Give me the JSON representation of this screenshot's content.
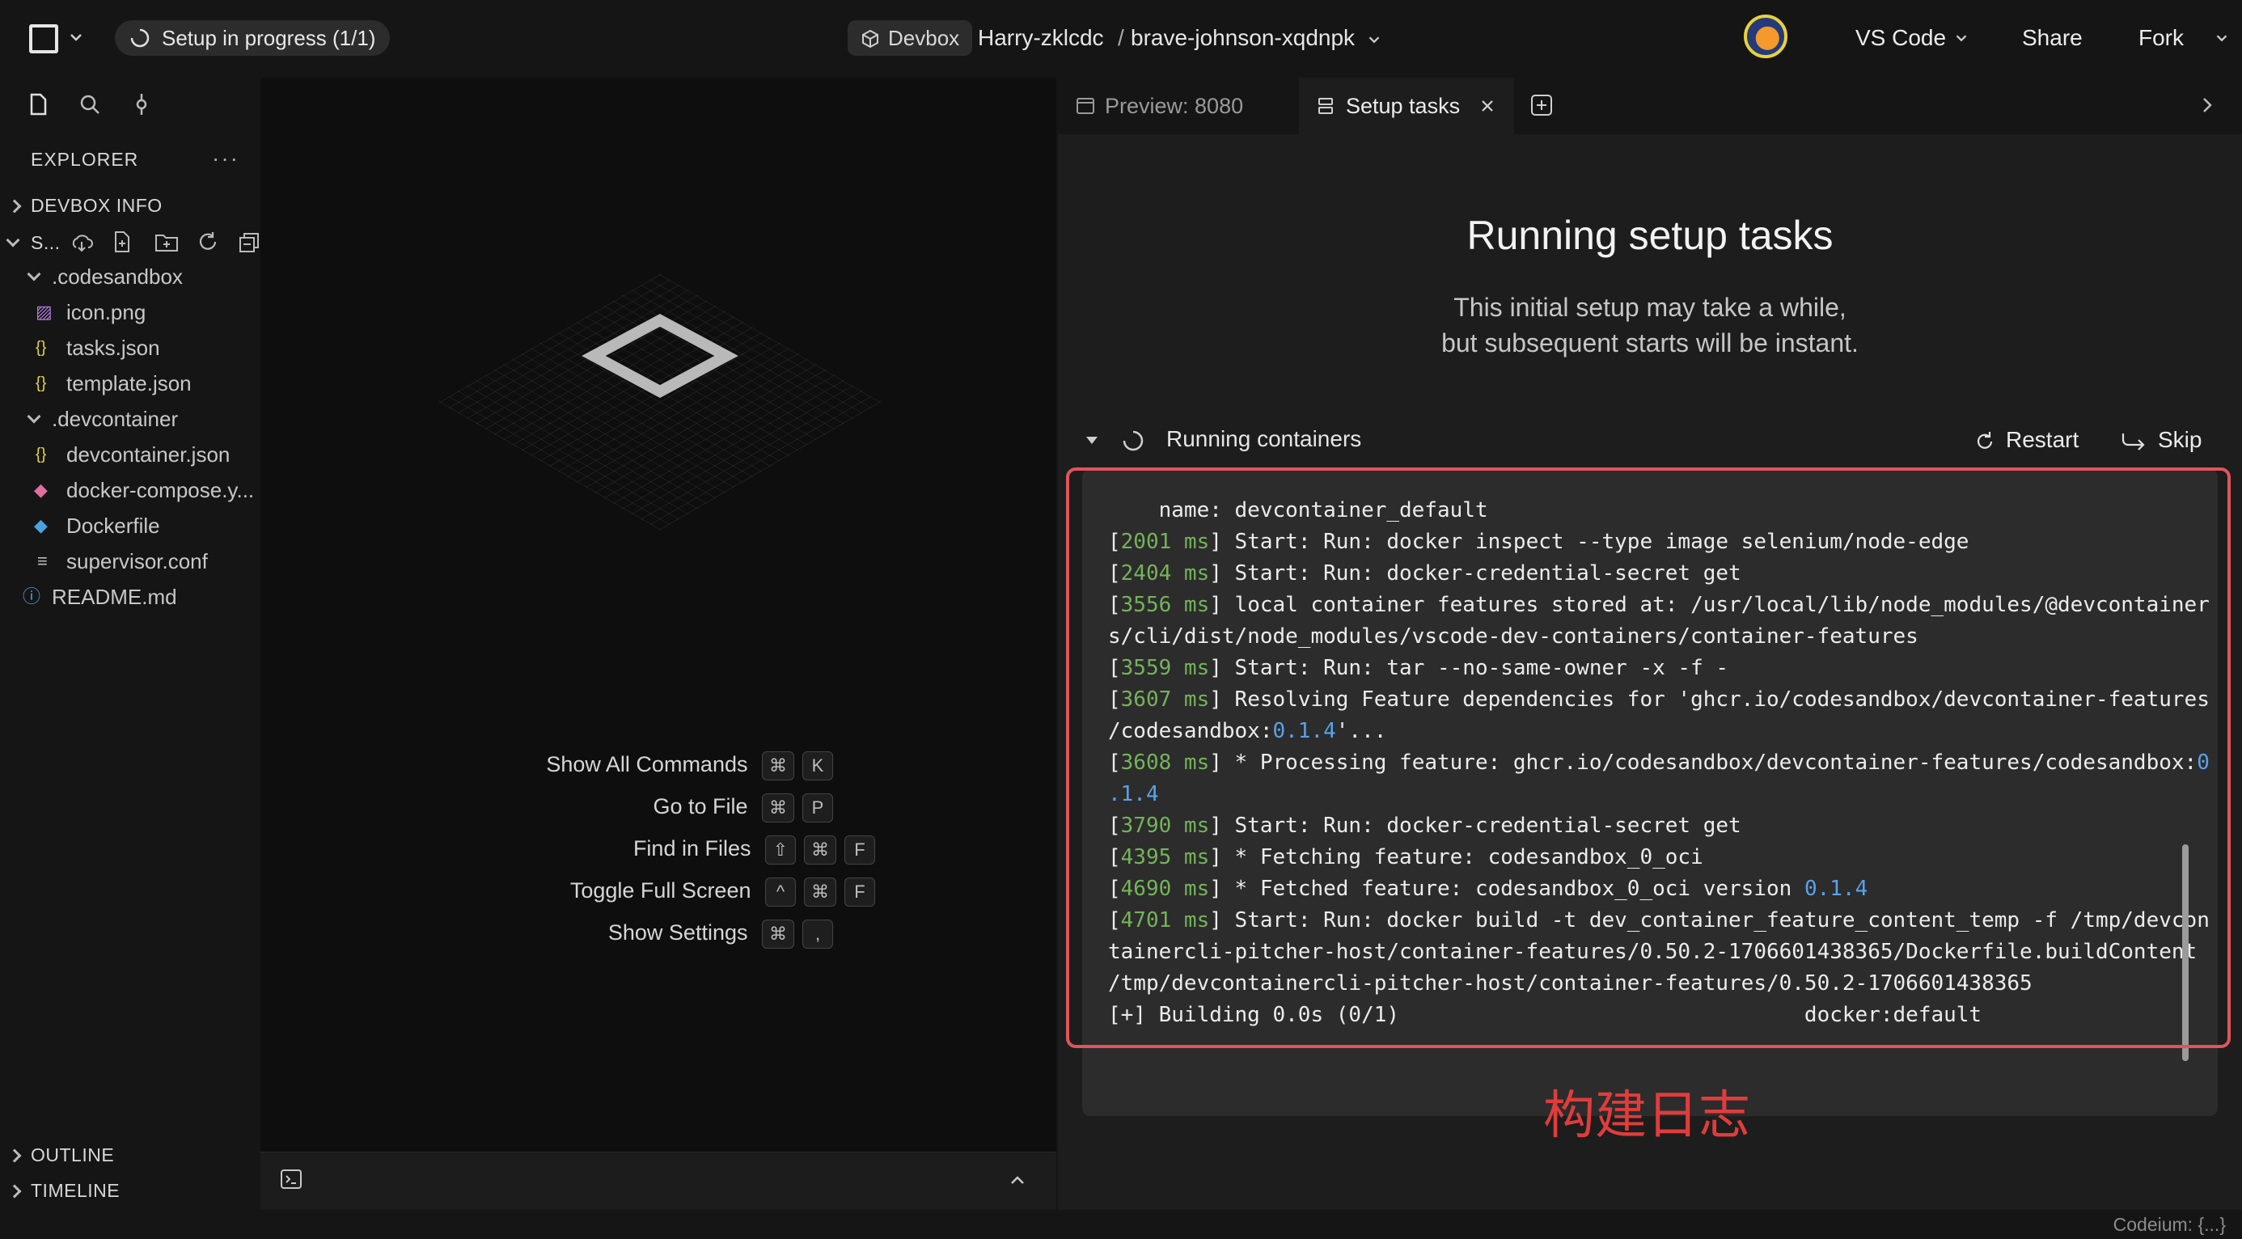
{
  "topbar": {
    "setup_status": "Setup in progress (1/1)",
    "devbox_label": "Devbox",
    "owner": "Harry-zklcdc",
    "separator": "/",
    "project": "brave-johnson-xqdnpk",
    "editor_select": "VS Code",
    "share": "Share",
    "fork": "Fork"
  },
  "explorer": {
    "title": "EXPLORER",
    "sections": {
      "devbox_info": "DEVBOX INFO",
      "workspace_short": "S...",
      "outline": "OUTLINE",
      "timeline": "TIMELINE"
    },
    "tree": [
      {
        "label": ".codesandbox",
        "type": "folder",
        "icon": "chevron-down-icon"
      },
      {
        "label": "icon.png",
        "type": "file",
        "icon": "image-icon"
      },
      {
        "label": "tasks.json",
        "type": "file",
        "icon": "json-icon"
      },
      {
        "label": "template.json",
        "type": "file",
        "icon": "json-icon"
      },
      {
        "label": ".devcontainer",
        "type": "folder",
        "icon": "chevron-down-icon"
      },
      {
        "label": "devcontainer.json",
        "type": "file",
        "icon": "json-icon"
      },
      {
        "label": "docker-compose.y...",
        "type": "file",
        "icon": "docker-compose-icon"
      },
      {
        "label": "Dockerfile",
        "type": "file",
        "icon": "docker-icon"
      },
      {
        "label": "supervisor.conf",
        "type": "file",
        "icon": "text-file-icon"
      },
      {
        "label": "README.md",
        "type": "file",
        "icon": "info-icon"
      }
    ]
  },
  "editor": {
    "commands": [
      {
        "label": "Show All Commands",
        "keys": [
          "⌘",
          "K"
        ]
      },
      {
        "label": "Go to File",
        "keys": [
          "⌘",
          "P"
        ]
      },
      {
        "label": "Find in Files",
        "keys": [
          "⇧",
          "⌘",
          "F"
        ]
      },
      {
        "label": "Toggle Full Screen",
        "keys": [
          "^",
          "⌘",
          "F"
        ]
      },
      {
        "label": "Show Settings",
        "keys": [
          "⌘",
          ","
        ]
      }
    ]
  },
  "tabs": {
    "preview": "Preview: 8080",
    "setup": "Setup tasks"
  },
  "setup": {
    "heading": "Running setup tasks",
    "sub_line1": "This initial setup may take a while,",
    "sub_line2": "but subsequent starts will be instant.",
    "task_name": "Running containers",
    "restart": "Restart",
    "skip": "Skip"
  },
  "log": {
    "lines": [
      {
        "ms": "",
        "text": "    name: devcontainer_default"
      },
      {
        "ms": "2001",
        "text": "Start: Run: docker inspect --type image selenium/node-edge"
      },
      {
        "ms": "2404",
        "text": "Start: Run: docker-credential-secret get"
      },
      {
        "ms": "3556",
        "text": "local container features stored at: /usr/local/lib/node_modules/@devcontainer"
      },
      {
        "ms": "",
        "text": "s/cli/dist/node_modules/vscode-dev-containers/container-features"
      },
      {
        "ms": "3559",
        "text": "Start: Run: tar --no-same-owner -x -f -"
      },
      {
        "ms": "3607",
        "text": "Resolving Feature dependencies for 'ghcr.io/codesandbox/devcontainer-features"
      },
      {
        "ms": "",
        "text": "/codesandbox:",
        "num": "0.1.4",
        "tail": "'..."
      },
      {
        "ms": "3608",
        "text": "* Processing feature: ghcr.io/codesandbox/devcontainer-features/codesandbox:",
        "num": "0"
      },
      {
        "ms": "",
        "text": "",
        "num": ".1.4"
      },
      {
        "ms": "3790",
        "text": "Start: Run: docker-credential-secret get"
      },
      {
        "ms": "4395",
        "text": "* Fetching feature: codesandbox_0_oci"
      },
      {
        "ms": "4690",
        "text": "* Fetched feature: codesandbox_0_oci version ",
        "num": "0.1.4"
      },
      {
        "ms": "4701",
        "text": "Start: Run: docker build -t dev_container_feature_content_temp -f /tmp/devcon"
      },
      {
        "ms": "",
        "text": "tainercli-pitcher-host/container-features/0.50.2-1706601438365/Dockerfile.buildContent"
      },
      {
        "ms": "",
        "text": "/tmp/devcontainercli-pitcher-host/container-features/0.50.2-1706601438365"
      },
      {
        "ms": "",
        "text": "[+] Building 0.0s (0/1)                                docker:default"
      }
    ]
  },
  "annotation": "构建日志",
  "status": {
    "codeium": "Codeium: {...}"
  },
  "colors": {
    "ms_green": "#74b35a",
    "version_blue": "#5aa2e8",
    "highlight_red": "#e0545c",
    "annotation_red": "#e03c3c"
  }
}
